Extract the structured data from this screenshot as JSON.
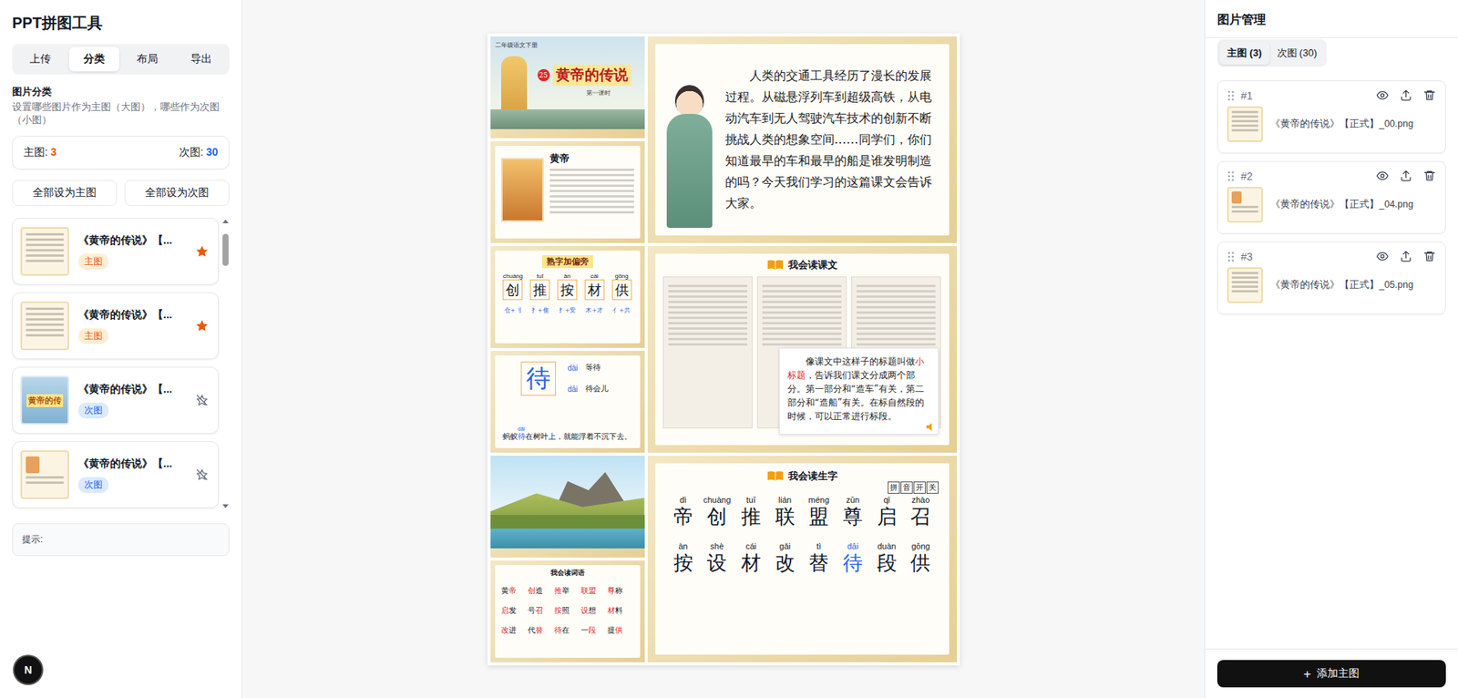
{
  "app": {
    "title": "PPT拼图工具"
  },
  "tabs": [
    {
      "label": "上传",
      "selected": false
    },
    {
      "label": "分类",
      "selected": true
    },
    {
      "label": "布局",
      "selected": false
    },
    {
      "label": "导出",
      "selected": false
    }
  ],
  "section": {
    "title": "图片分类",
    "subtitle": "设置哪些图片作为主图（大图），哪些作为次图（小图）"
  },
  "counts": [
    {
      "label": "主图:",
      "value": "3",
      "color": "#ea580c"
    },
    {
      "label": "次图:",
      "value": "30",
      "color": "#2563eb"
    }
  ],
  "bulk_buttons": [
    {
      "label": "全部设为主图"
    },
    {
      "label": "全部设为次图"
    }
  ],
  "image_list": {
    "scroll_level": 0.12,
    "items": [
      {
        "title": "《黄帝的传说》【...",
        "badge": "主图",
        "kind": "main",
        "starred": true,
        "color": "#ea580c",
        "thumb": {
          "kind": "doc"
        }
      },
      {
        "title": "《黄帝的传说》【...",
        "badge": "主图",
        "kind": "main",
        "starred": true,
        "color": "#ea580c",
        "thumb": {
          "kind": "doc"
        }
      },
      {
        "title": "《黄帝的传说》【...",
        "badge": "次图",
        "kind": "secondary",
        "starred": false,
        "color": "#2563eb",
        "thumb": {
          "kind": "cover",
          "text": "黄帝的传"
        }
      },
      {
        "title": "《黄帝的传说》【...",
        "badge": "次图",
        "kind": "secondary",
        "starred": false,
        "color": "#2563eb",
        "thumb": {
          "kind": "portrait"
        }
      }
    ]
  },
  "hint": {
    "label": "提示:"
  },
  "dev_badge": {
    "label": "N"
  },
  "collage": {
    "rows": [
      {
        "secondary": [
          {
            "kind": "cover",
            "grade": "二年级语文下册",
            "number": "25",
            "title": "黄帝的传说",
            "lesson": "第一课时"
          },
          {
            "kind": "bio",
            "title": "黄帝"
          }
        ],
        "main": {
          "kind": "text",
          "paragraph": "人类的交通工具经历了漫长的发展过程。从磁悬浮列车到超级高铁，从电动汽车到无人驾驶汽车技术的创新不断挑战人类的想象空间……同学们，你们知道最早的车和最早的船是谁发明制造的吗？今天我们学习的这篇课文会告诉大家。"
        }
      },
      {
        "secondary": [
          {
            "kind": "radicals",
            "title": "熟字加偏旁",
            "chars": [
              {
                "pinyin": "chuàng",
                "char": "创",
                "parts": "仓+刂"
              },
              {
                "pinyin": "tuī",
                "char": "推",
                "parts": "扌+隹"
              },
              {
                "pinyin": "àn",
                "char": "按",
                "parts": "扌+安"
              },
              {
                "pinyin": "cái",
                "char": "材",
                "parts": "木+才"
              },
              {
                "pinyin": "gōng",
                "char": "供",
                "parts": "亻+共"
              }
            ]
          },
          {
            "kind": "char-detail",
            "char": "待",
            "readings": [
              {
                "pinyin": "dài",
                "word": "等待"
              },
              {
                "pinyin": "dāi",
                "word": "待会儿"
              }
            ],
            "sentence": {
              "before": "蚂蚁",
              "pinyin": "dāi",
              "char": "待",
              "after": "在树叶上，就能浮着不沉下去。"
            }
          }
        ],
        "main": {
          "kind": "lesson",
          "title": "我会读课文",
          "note": [
            {
              "text": "像课文中这样子的标题叫做",
              "highlight": false
            },
            {
              "text": "小标题",
              "highlight": true
            },
            {
              "text": "，告诉我们课文分成两个部分。第一部分和“造车”有关，第二部分和“造船”有关。在标自然段的时候，可以正常进行标段。",
              "highlight": false
            }
          ]
        }
      },
      {
        "secondary": [
          {
            "kind": "picture"
          },
          {
            "kind": "words",
            "title": "我会读词语",
            "words": [
              {
                "text": "黄帝",
                "highlight": "帝"
              },
              {
                "text": "创造",
                "highlight": "创"
              },
              {
                "text": "推举",
                "highlight": "推"
              },
              {
                "text": "联盟",
                "highlight": "联盟"
              },
              {
                "text": "尊称",
                "highlight": "尊"
              },
              {
                "text": "启发",
                "highlight": "启"
              },
              {
                "text": "号召",
                "highlight": "召"
              },
              {
                "text": "按照",
                "highlight": "按"
              },
              {
                "text": "设想",
                "highlight": "设"
              },
              {
                "text": "材料",
                "highlight": "材"
              },
              {
                "text": "改进",
                "highlight": "改"
              },
              {
                "text": "代替",
                "highlight": "替"
              },
              {
                "text": "待在",
                "highlight": "待"
              },
              {
                "text": "一段",
                "highlight": "段"
              },
              {
                "text": "提供",
                "highlight": "供"
              }
            ]
          }
        ],
        "main": {
          "kind": "chars",
          "title": "我会读生字",
          "toggle": [
            "拼",
            "音",
            "开",
            "关"
          ],
          "rows": [
            [
              {
                "pinyin": "dì",
                "char": "帝",
                "highlight": false
              },
              {
                "pinyin": "chuàng",
                "char": "创",
                "highlight": false
              },
              {
                "pinyin": "tuī",
                "char": "推",
                "highlight": false
              },
              {
                "pinyin": "lián",
                "char": "联",
                "highlight": false
              },
              {
                "pinyin": "méng",
                "char": "盟",
                "highlight": false
              },
              {
                "pinyin": "zūn",
                "char": "尊",
                "highlight": false
              },
              {
                "pinyin": "qǐ",
                "char": "启",
                "highlight": false
              },
              {
                "pinyin": "zhào",
                "char": "召",
                "highlight": false
              }
            ],
            [
              {
                "pinyin": "àn",
                "char": "按",
                "highlight": false
              },
              {
                "pinyin": "shè",
                "char": "设",
                "highlight": false
              },
              {
                "pinyin": "cái",
                "char": "材",
                "highlight": false
              },
              {
                "pinyin": "gǎi",
                "char": "改",
                "highlight": false
              },
              {
                "pinyin": "tì",
                "char": "替",
                "highlight": false
              },
              {
                "pinyin": "dāi",
                "char": "待",
                "highlight": true
              },
              {
                "pinyin": "duàn",
                "char": "段",
                "highlight": false
              },
              {
                "pinyin": "gōng",
                "char": "供",
                "highlight": false
              }
            ]
          ]
        }
      }
    ]
  },
  "manager": {
    "title": "图片管理",
    "tabs": [
      {
        "label": "主图 (3)",
        "selected": true
      },
      {
        "label": "次图 (30)",
        "selected": false
      }
    ],
    "cards": [
      {
        "index": "#1",
        "file": "《黄帝的传说》【正式】_00.png",
        "thumb": "doc"
      },
      {
        "index": "#2",
        "file": "《黄帝的传说》【正式】_04.png",
        "thumb": "portrait"
      },
      {
        "index": "#3",
        "file": "《黄帝的传说》【正式】_05.png",
        "thumb": "doc"
      }
    ],
    "add_button": {
      "icon": "+",
      "label": "添加主图"
    }
  }
}
